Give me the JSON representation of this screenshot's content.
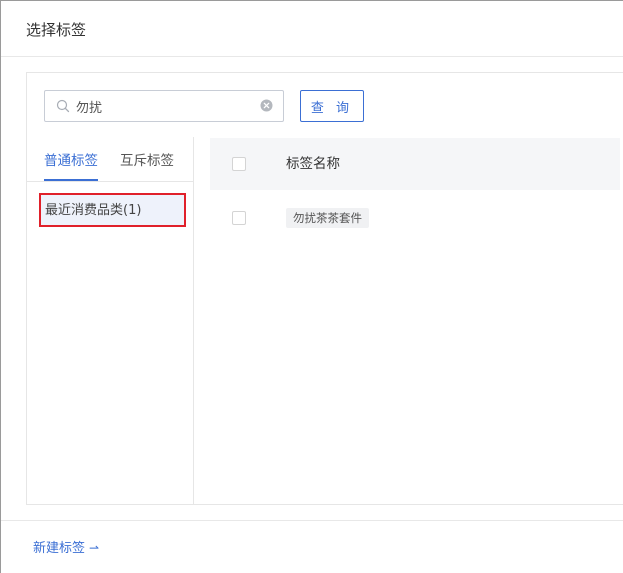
{
  "dialog": {
    "title": "选择标签"
  },
  "search": {
    "value": "勿扰",
    "query_label": "查 询"
  },
  "tabs": [
    {
      "label": "普通标签",
      "active": true
    },
    {
      "label": "互斥标签",
      "active": false
    }
  ],
  "categories": [
    {
      "label": "最近消费品类(1)",
      "selected": true
    }
  ],
  "table": {
    "header": "标签名称",
    "rows": [
      {
        "tag": "勿扰茶茶套件",
        "checked": false
      }
    ]
  },
  "footer": {
    "new_tag_label": "新建标签",
    "new_tag_arrow": "⇀"
  },
  "colors": {
    "accent": "#3b6fd4",
    "highlight_border": "#e0202a",
    "selected_bg": "#eef2fb"
  }
}
